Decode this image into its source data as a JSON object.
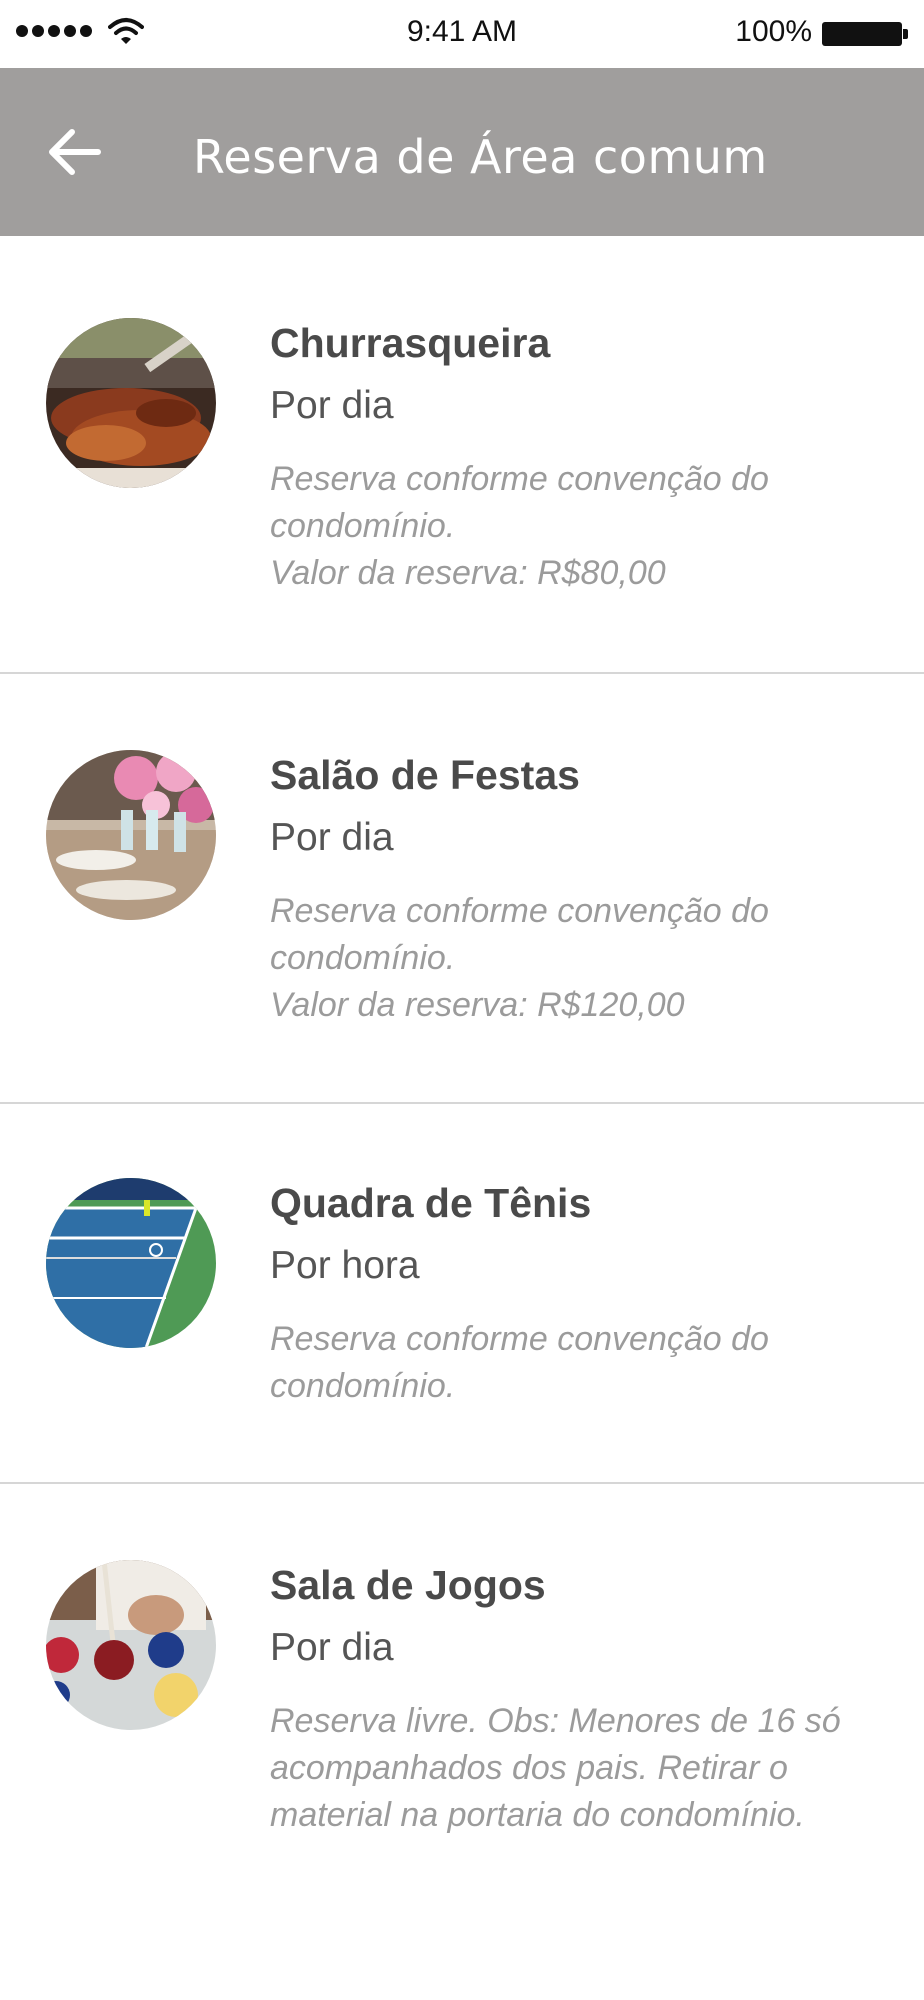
{
  "status_bar": {
    "time": "9:41 AM",
    "battery": "100%"
  },
  "header": {
    "title": "Reserva de Área comum",
    "back_icon": "arrow-left-icon"
  },
  "items": [
    {
      "name": "Churrasqueira",
      "period": "Por dia",
      "description": [
        "Reserva conforme convenção do",
        "condomínio.",
        "Valor da reserva: R$80,00"
      ],
      "image": "barbecue-photo"
    },
    {
      "name": "Salão de Festas",
      "period": "Por dia",
      "description": [
        "Reserva conforme convenção do",
        "condomínio.",
        "Valor da reserva: R$120,00"
      ],
      "image": "party-hall-photo"
    },
    {
      "name": "Quadra de Tênis",
      "period": "Por hora",
      "description": [
        "Reserva conforme convenção do",
        "condomínio."
      ],
      "image": "tennis-court-photo"
    },
    {
      "name": "Sala de Jogos",
      "period": "Por dia",
      "description": [
        "Reserva livre. Obs: Menores de 16 só",
        "acompanhados dos pais. Retirar o",
        "material na portaria do condomínio."
      ],
      "image": "billiards-photo"
    }
  ],
  "colors": {
    "app_bar": "#a09e9d",
    "title_text": "#ffffff",
    "item_name": "#4a4a4a",
    "item_description": "#9b9b9b",
    "divider": "#d6d6d6"
  }
}
